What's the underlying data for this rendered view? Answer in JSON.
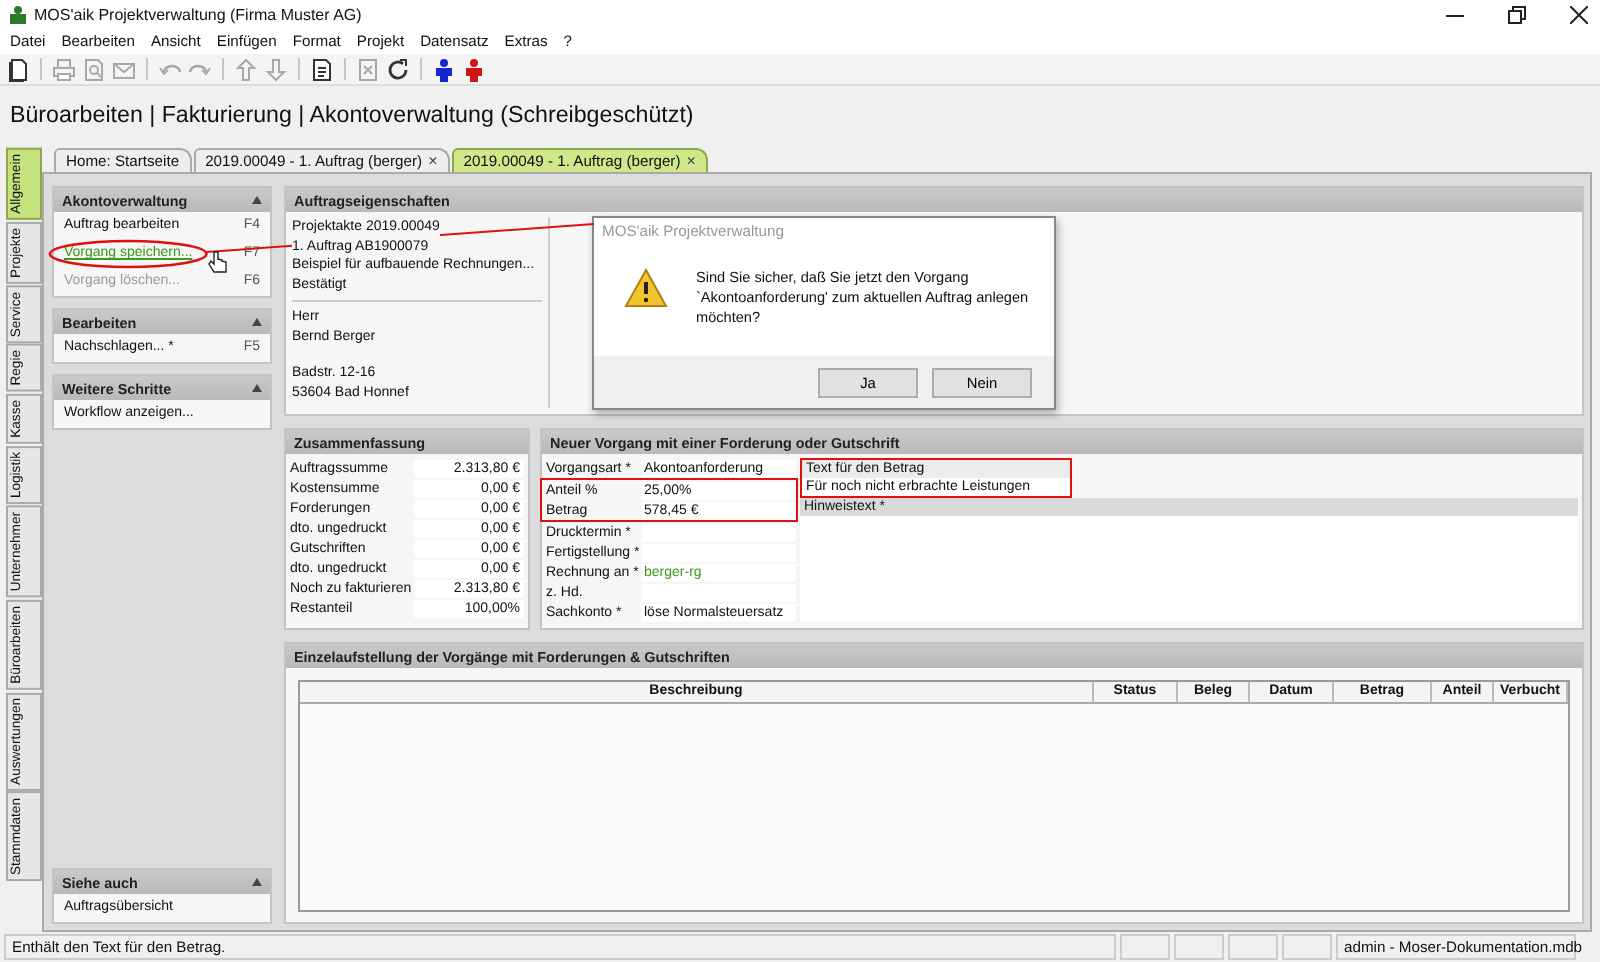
{
  "window": {
    "title": "MOS'aik Projektverwaltung (Firma Muster AG)"
  },
  "menu": [
    "Datei",
    "Bearbeiten",
    "Ansicht",
    "Einfügen",
    "Format",
    "Projekt",
    "Datensatz",
    "Extras",
    "?"
  ],
  "toolbar": [
    {
      "kind": "new",
      "disabled": false
    },
    {
      "kind": "separator"
    },
    {
      "kind": "print",
      "disabled": true
    },
    {
      "kind": "preview",
      "disabled": true
    },
    {
      "kind": "mail",
      "disabled": true
    },
    {
      "kind": "separator"
    },
    {
      "kind": "undo",
      "disabled": true
    },
    {
      "kind": "redo",
      "disabled": true
    },
    {
      "kind": "separator"
    },
    {
      "kind": "up",
      "disabled": true
    },
    {
      "kind": "down",
      "disabled": true
    },
    {
      "kind": "separator"
    },
    {
      "kind": "report",
      "disabled": false
    },
    {
      "kind": "separator"
    },
    {
      "kind": "cancel",
      "disabled": true
    },
    {
      "kind": "refresh",
      "disabled": false
    },
    {
      "kind": "separator"
    },
    {
      "kind": "figure",
      "disabled": false,
      "color": "#1428d2"
    },
    {
      "kind": "figure",
      "disabled": false,
      "color": "#d21414"
    }
  ],
  "heading": "Büroarbeiten | Fakturierung | Akontoverwaltung (Schreibgeschützt)",
  "side_tabs": [
    {
      "label": "Allgemein",
      "selected": true
    },
    {
      "label": "Projekte",
      "selected": false
    },
    {
      "label": "Service",
      "selected": false
    },
    {
      "label": "Regie",
      "selected": false
    },
    {
      "label": "Kasse",
      "selected": false
    },
    {
      "label": "Logistik",
      "selected": false
    },
    {
      "label": "Unternehmer",
      "selected": false
    },
    {
      "label": "Büroarbeiten",
      "selected": false
    },
    {
      "label": "Auswertungen",
      "selected": false
    },
    {
      "label": "Stammdaten",
      "selected": false
    }
  ],
  "doc_tabs": [
    {
      "label": "Home: Startseite",
      "selected": false
    },
    {
      "label": "2019.00049 - 1. Auftrag (berger)",
      "selected": false,
      "close": "×"
    },
    {
      "label": "2019.00049 - 1. Auftrag (berger)",
      "selected": true,
      "close": "×"
    }
  ],
  "left_panels": [
    {
      "title": "Akontoverwaltung",
      "items": [
        {
          "label": "Auftrag bearbeiten",
          "key": "F4",
          "hovered": false,
          "disabled": false
        },
        {
          "label": "Vorgang speichern...",
          "key": "F7",
          "hovered": true,
          "disabled": false
        },
        {
          "label": "Vorgang löschen...",
          "key": "F6",
          "hovered": false,
          "disabled": true
        }
      ]
    },
    {
      "title": "Bearbeiten",
      "items": [
        {
          "label": "Nachschlagen...  *",
          "key": "F5",
          "hovered": false,
          "disabled": false
        }
      ]
    },
    {
      "title": "Weitere Schritte",
      "items": [
        {
          "label": "Workflow anzeigen...",
          "hovered": false,
          "disabled": false
        }
      ]
    }
  ],
  "see_also": {
    "title": "Siehe auch",
    "items": [
      "Auftragsübersicht"
    ]
  },
  "order_properties": {
    "title": "Auftragseigenschaften",
    "lines": [
      "Projektakte 2019.00049",
      "1. Auftrag AB1900079",
      "Beispiel für aufbauende Rechnungen...",
      "Bestätigt"
    ],
    "contact": [
      "Herr",
      "Bernd Berger"
    ],
    "address": [
      "Badstr. 12-16",
      "53604 Bad Honnef"
    ]
  },
  "summary": {
    "title": "Zusammenfassung",
    "rows": [
      {
        "label": "Auftragssumme",
        "value": "2.313,80 €"
      },
      {
        "label": "Kostensumme",
        "value": "0,00 €"
      },
      {
        "label": "Forderungen",
        "value": "0,00 €"
      },
      {
        "label": "dto. ungedruckt",
        "value": "0,00 €"
      },
      {
        "label": "Gutschriften",
        "value": "0,00 €"
      },
      {
        "label": "dto. ungedruckt",
        "value": "0,00 €"
      },
      {
        "label": "Noch zu fakturieren",
        "value": "2.313,80 €"
      },
      {
        "label": "Restanteil",
        "value": "100,00%"
      }
    ]
  },
  "new_entry": {
    "title": "Neuer Vorgang mit einer Forderung oder Gutschrift",
    "fields": [
      {
        "label": "Vorgangsart *",
        "value": "Akontoanforderung",
        "highlighted": false,
        "link": false
      },
      {
        "label": "Anteil %",
        "value": "25,00%",
        "highlighted": true,
        "link": false
      },
      {
        "label": "Betrag",
        "value": "578,45 €",
        "highlighted": true,
        "link": false
      },
      {
        "label": "Drucktermin *",
        "highlighted": false
      },
      {
        "label": "Fertigstellung *",
        "highlighted": false
      },
      {
        "label": "Rechnung an *",
        "value": "berger-rg",
        "highlighted": false,
        "link": true
      },
      {
        "label": "z. Hd.",
        "highlighted": false
      },
      {
        "label": "Sachkonto *",
        "value": "löse Normalsteuersatz",
        "highlighted": false,
        "link": false
      }
    ],
    "text_label": "Text für den Betrag",
    "text_value": "Für noch nicht erbrachte Leistungen",
    "text_highlighted": true,
    "note_label": "Hinweistext *"
  },
  "details": {
    "title": "Einzelaufstellung der Vorgänge mit Forderungen & Gutschriften",
    "columns": [
      "Beschreibung",
      "Status",
      "Beleg",
      "Datum",
      "Betrag",
      "Anteil",
      "Verbucht"
    ]
  },
  "dialog": {
    "title": "MOS'aik Projektverwaltung",
    "message": "Sind Sie sicher, daß Sie jetzt den Vorgang `Akontoanforderung' zum aktuellen Auftrag anlegen möchten?",
    "buttons": [
      "Ja",
      "Nein"
    ]
  },
  "status_bar": {
    "text": "Enthält den Text für den Betrag.",
    "info": "admin - Moser-Dokumentation.mdb"
  }
}
